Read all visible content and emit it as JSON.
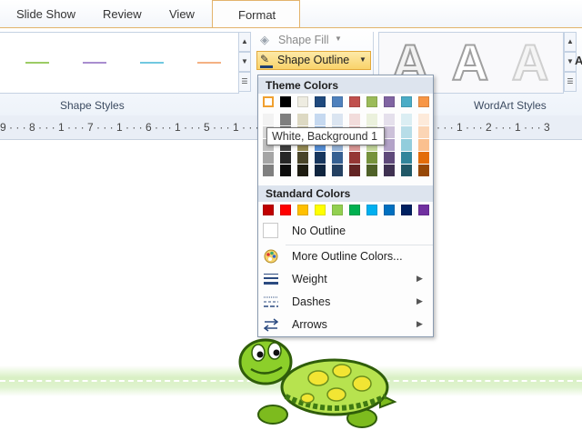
{
  "tabs": {
    "slide_show": "Slide Show",
    "review": "Review",
    "view": "View",
    "format": "Format"
  },
  "ribbon": {
    "shape_fill": "Shape Fill",
    "shape_outline": "Shape Outline",
    "shape_styles_label": "Shape Styles",
    "wordart_styles_label": "WordArt Styles",
    "wordart_letter": "A",
    "style_line_colors": [
      "#9ccc65",
      "#a98dcf",
      "#71c8e0",
      "#f4b183"
    ]
  },
  "ruler": {
    "left_text": "9 · · · 8 · · · 1 · · · 7 · · · 1 · · · 6 · · · 1 · · · 5 · · · 1 · · · 4 · · · 1 · · · 3 · · · 1 · · · 2",
    "right_text": "· · · 1 · · · 2 · · · 1 · · · 3"
  },
  "menu": {
    "theme_colors_header": "Theme Colors",
    "standard_colors_header": "Standard Colors",
    "no_outline": "No Outline",
    "more_colors": "More Outline Colors...",
    "weight": "Weight",
    "dashes": "Dashes",
    "arrows": "Arrows",
    "tooltip": "White, Background 1",
    "theme_colors": [
      "#ffffff",
      "#000000",
      "#eeece1",
      "#1f497d",
      "#4f81bd",
      "#c0504d",
      "#9bbb59",
      "#8064a2",
      "#4bacc6",
      "#f79646"
    ],
    "theme_shades": [
      [
        "#f2f2f2",
        "#d8d8d8",
        "#bfbfbf",
        "#a5a5a5",
        "#7f7f7f"
      ],
      [
        "#7f7f7f",
        "#595959",
        "#3f3f3f",
        "#262626",
        "#0c0c0c"
      ],
      [
        "#ddd9c3",
        "#c4bd97",
        "#938953",
        "#494429",
        "#1d1b10"
      ],
      [
        "#c6d9f0",
        "#8db3e2",
        "#548dd4",
        "#17365d",
        "#0f243e"
      ],
      [
        "#dbe5f1",
        "#b8cce4",
        "#95b3d7",
        "#366092",
        "#244061"
      ],
      [
        "#f2dcdb",
        "#e5b9b7",
        "#d99694",
        "#953734",
        "#632423"
      ],
      [
        "#ebf1dd",
        "#d7e3bc",
        "#c3d69b",
        "#76923c",
        "#4f6128"
      ],
      [
        "#e5e0ec",
        "#ccc1d9",
        "#b2a2c7",
        "#5f497a",
        "#3f3151"
      ],
      [
        "#dbeef3",
        "#b7dde8",
        "#92cddc",
        "#31859b",
        "#205867"
      ],
      [
        "#fdeada",
        "#fbd5b5",
        "#fac08f",
        "#e36c09",
        "#974806"
      ]
    ],
    "standard_colors": [
      "#c00000",
      "#ff0000",
      "#ffc000",
      "#ffff00",
      "#92d050",
      "#00b050",
      "#00b0f0",
      "#0070c0",
      "#002060",
      "#7030a0"
    ]
  }
}
